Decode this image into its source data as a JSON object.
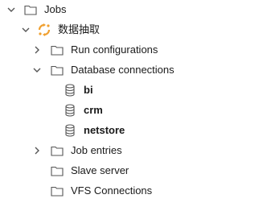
{
  "tree": {
    "jobs_label": "Jobs",
    "job_name": "数据抽取",
    "run_configurations": "Run configurations",
    "database_connections": "Database connections",
    "connections": [
      "bi",
      "crm",
      "netstore"
    ],
    "job_entries": "Job entries",
    "slave_server": "Slave server",
    "vfs_connections": "VFS Connections"
  },
  "colors": {
    "job_icon_orange": "#f0a030",
    "icon_stroke": "#555555"
  }
}
